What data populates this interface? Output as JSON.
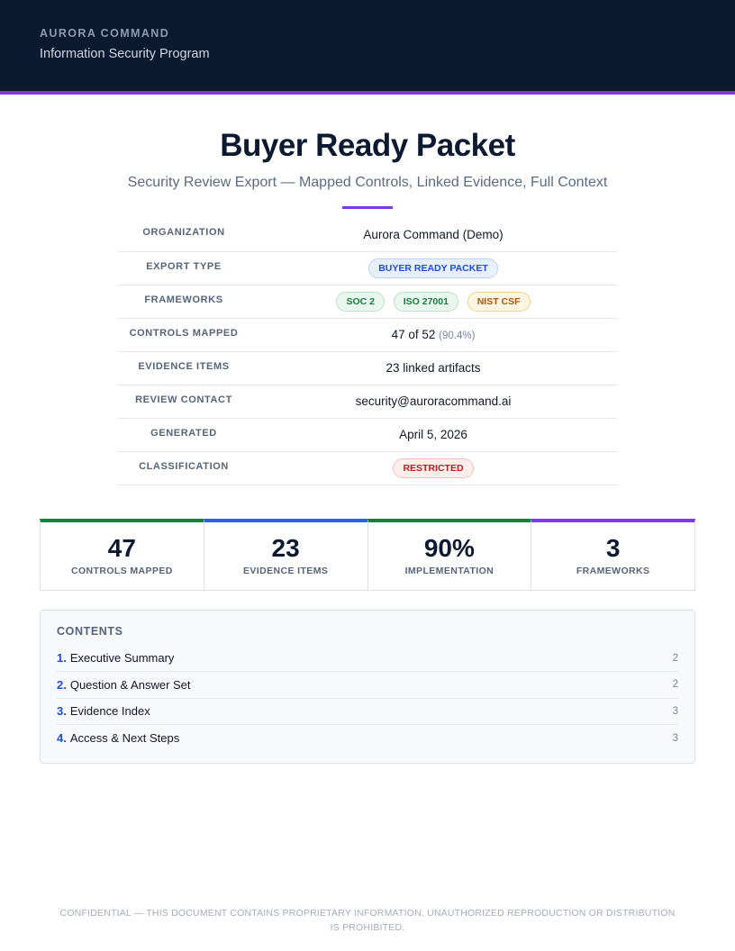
{
  "header": {
    "brand": "AURORA COMMAND",
    "program": "Information Security Program"
  },
  "title": "Buyer Ready Packet",
  "subtitle": "Security Review Export — Mapped Controls, Linked Evidence, Full Context",
  "meta": {
    "organization_label": "ORGANIZATION",
    "organization": "Aurora Command (Demo)",
    "export_type_label": "EXPORT TYPE",
    "export_type": "BUYER READY PACKET",
    "frameworks_label": "FRAMEWORKS",
    "frameworks": [
      "SOC 2",
      "ISO 27001",
      "NIST CSF"
    ],
    "controls_label": "CONTROLS MAPPED",
    "controls": "47 of 52",
    "controls_pct": "(90.4%)",
    "evidence_label": "EVIDENCE ITEMS",
    "evidence": "23 linked artifacts",
    "contact_label": "REVIEW CONTACT",
    "contact": "security@auroracommand.ai",
    "generated_label": "GENERATED",
    "generated": "April 5, 2026",
    "classification_label": "CLASSIFICATION",
    "classification": "RESTRICTED"
  },
  "stats": [
    {
      "value": "47",
      "label": "CONTROLS MAPPED",
      "color": "#15803d"
    },
    {
      "value": "23",
      "label": "EVIDENCE ITEMS",
      "color": "#2563eb"
    },
    {
      "value": "90%",
      "label": "IMPLEMENTATION",
      "color": "#15803d"
    },
    {
      "value": "3",
      "label": "FRAMEWORKS",
      "color": "#7c3aed"
    }
  ],
  "contents": {
    "title": "CONTENTS",
    "items": [
      {
        "num": "1.",
        "label": "Executive Summary",
        "page": "2"
      },
      {
        "num": "2.",
        "label": "Question & Answer Set",
        "page": "2"
      },
      {
        "num": "3.",
        "label": "Evidence Index",
        "page": "3"
      },
      {
        "num": "4.",
        "label": "Access & Next Steps",
        "page": "3"
      }
    ]
  },
  "footer": "CONFIDENTIAL — THIS DOCUMENT CONTAINS PROPRIETARY INFORMATION. UNAUTHORIZED REPRODUCTION OR DISTRIBUTION IS PROHIBITED.",
  "colors": {
    "header_bg": "#0b1931",
    "accent": "#7c3aed"
  }
}
